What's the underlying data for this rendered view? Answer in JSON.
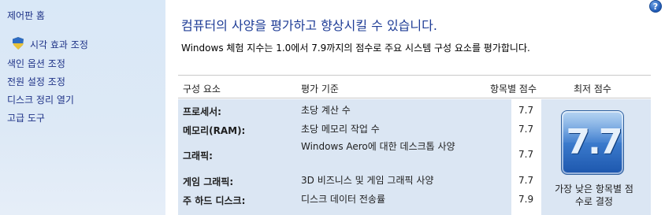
{
  "sidebar": {
    "home": "제어판 홈",
    "items": [
      {
        "label": "시각 효과 조정",
        "icon": "shield-icon"
      },
      {
        "label": "색인 옵션 조정"
      },
      {
        "label": "전원 설정 조정"
      },
      {
        "label": "디스크 정리 열기"
      },
      {
        "label": "고급 도구"
      }
    ]
  },
  "help": {
    "label": "?"
  },
  "main": {
    "headline": "컴퓨터의 사양을 평가하고 향상시킬 수 있습니다.",
    "subline": "Windows 체험 지수는 1.0에서 7.9까지의 점수로 주요 시스템 구성 요소를 평가합니다."
  },
  "table": {
    "headers": [
      "구성 요소",
      "평가 기준",
      "항목별 점수",
      "최저 점수"
    ],
    "rows": [
      {
        "component": "프로세서:",
        "criteria": "초당 계산 수",
        "score": "7.7"
      },
      {
        "component": "메모리(RAM):",
        "criteria": "초당 메모리 작업 수",
        "score": "7.7"
      },
      {
        "component": "그래픽:",
        "criteria": "Windows Aero에 대한 데스크톱 사양",
        "score": "7.7"
      },
      {
        "component": "게임 그래픽:",
        "criteria": "3D 비즈니스 및 게임 그래픽 사양",
        "score": "7.7"
      },
      {
        "component": "주 하드 디스크:",
        "criteria": "디스크 데이터 전송률",
        "score": "7.9"
      }
    ],
    "base_score": "7.7",
    "base_caption": "가장 낮은 항목별 점수로 결정"
  },
  "colors": {
    "link": "#1e3287",
    "headline": "#1e3c96",
    "sidebar_bg": "#dde9f6",
    "table_band": "#dbe6f3"
  }
}
